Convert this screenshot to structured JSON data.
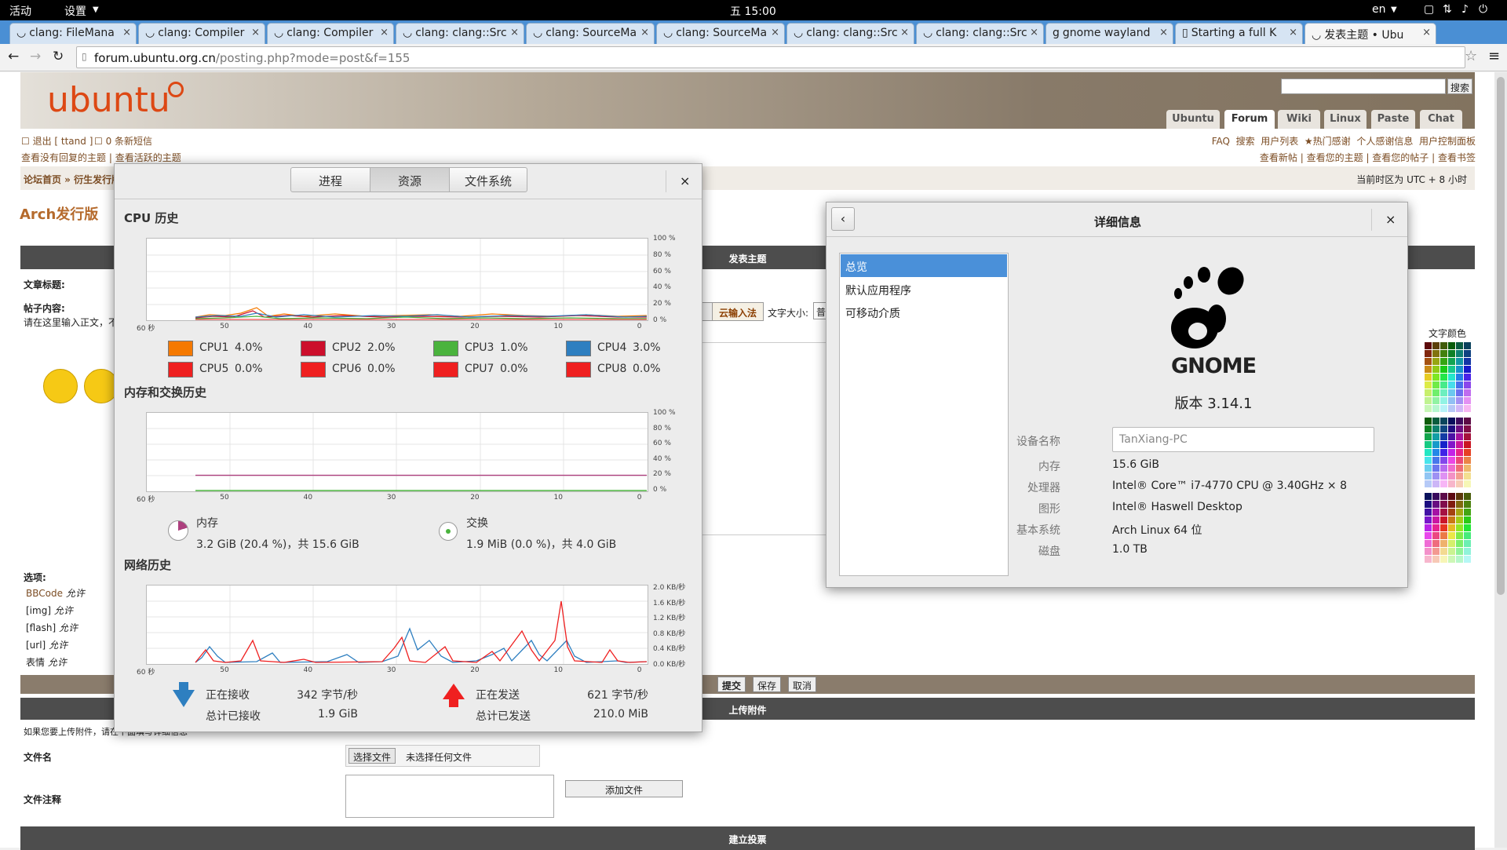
{
  "topbar": {
    "activities": "活动",
    "app_menu": "设置",
    "clock": "五 15:00",
    "lang": "en"
  },
  "tabs": [
    {
      "label": "clang: FileMana"
    },
    {
      "label": "clang: Compiler"
    },
    {
      "label": "clang: Compiler"
    },
    {
      "label": "clang: clang::Src"
    },
    {
      "label": "clang: SourceMa"
    },
    {
      "label": "clang: SourceMa"
    },
    {
      "label": "clang: clang::Src"
    },
    {
      "label": "clang: clang::Src"
    },
    {
      "label": "gnome wayland"
    },
    {
      "label": "Starting a full K"
    },
    {
      "label": "发表主题 • Ubu"
    }
  ],
  "address": {
    "domain": "forum.ubuntu.org.cn",
    "path": "/posting.php?mode=post&f=155"
  },
  "forum": {
    "logo": "ubuntu",
    "search_btn": "搜索",
    "nav_tabs": [
      "Ubuntu",
      "Forum",
      "Wiki",
      "Linux",
      "Paste",
      "Chat"
    ],
    "user_links": [
      "退出 [ ttand ]",
      "0 条新短信"
    ],
    "right_links": [
      "FAQ",
      "搜索",
      "用户列表",
      "热门感谢",
      "个人感谢信息",
      "用户控制面板"
    ],
    "topic_links": [
      "查看没有回复的主题",
      "查看活跃的主题"
    ],
    "right_links2": [
      "查看新帖",
      "查看您的主题",
      "查看您的帖子",
      "查看书签"
    ],
    "breadcrumb": "论坛首页 » 衍生发行版",
    "timezone": "当前时区为 UTC + 8 小时",
    "forum_title": "Arch发行版",
    "post_bar": "发表主题",
    "subject_label": "文章标题:",
    "content_label": "帖子内容:",
    "content_hint": "请在这里输入正文，不",
    "ime_btn": "云输入法",
    "fontsize_label": "文字大小:",
    "fontsize_val": "普通",
    "color_label": "文字颜色",
    "options_label": "选项:",
    "options": [
      [
        "BBCode",
        "允许"
      ],
      [
        "[img]",
        "允许"
      ],
      [
        "[flash]",
        "允许"
      ],
      [
        "[url]",
        "允许"
      ],
      [
        "表情",
        "允许"
      ]
    ],
    "buttons": [
      "提交",
      "保存",
      "取消"
    ],
    "upload_bar": "上传附件",
    "upload_hint": "如果您要上传附件，请在下面填写详细信息",
    "file_label": "文件名",
    "choose_file": "选择文件",
    "no_file": "未选择任何文件",
    "comment_label": "文件注释",
    "add_file": "添加文件",
    "poll_bar": "建立投票"
  },
  "sysmon": {
    "tabs": [
      "进程",
      "资源",
      "文件系统"
    ],
    "cpu_title": "CPU 历史",
    "mem_title": "内存和交换历史",
    "net_title": "网络历史",
    "x_labels": [
      "60 秒",
      "50",
      "40",
      "30",
      "20",
      "10",
      "0"
    ],
    "pct_labels": [
      "100 %",
      "80 %",
      "60 %",
      "40 %",
      "20 %",
      "0 %"
    ],
    "net_labels": [
      "2.0 KB/秒",
      "1.6 KB/秒",
      "1.2 KB/秒",
      "0.8 KB/秒",
      "0.4 KB/秒",
      "0.0 KB/秒"
    ],
    "cpus": [
      {
        "name": "CPU1",
        "val": "4.0%",
        "color": "#f57900"
      },
      {
        "name": "CPU2",
        "val": "2.0%",
        "color": "#cc0f2c"
      },
      {
        "name": "CPU3",
        "val": "1.0%",
        "color": "#4ab33d"
      },
      {
        "name": "CPU4",
        "val": "3.0%",
        "color": "#2e7fc0"
      },
      {
        "name": "CPU5",
        "val": "0.0%",
        "color": "#ef2020"
      },
      {
        "name": "CPU6",
        "val": "0.0%",
        "color": "#ef2020"
      },
      {
        "name": "CPU7",
        "val": "0.0%",
        "color": "#ef2020"
      },
      {
        "name": "CPU8",
        "val": "0.0%",
        "color": "#ef2020"
      }
    ],
    "mem": {
      "label": "内存",
      "detail": "3.2 GiB (20.4 %)，共 15.6 GiB",
      "color": "#ad3f7e"
    },
    "swap": {
      "label": "交换",
      "detail": "1.9 MiB (0.0 %)，共 4.0 GiB",
      "color": "#4ab33d"
    },
    "recv": {
      "label": "正在接收",
      "rate": "342 字节/秒",
      "total_label": "总计已接收",
      "total": "1.9 GiB"
    },
    "send": {
      "label": "正在发送",
      "rate": "621 字节/秒",
      "total_label": "总计已发送",
      "total": "210.0 MiB"
    }
  },
  "details": {
    "title": "详细信息",
    "sidebar": [
      "总览",
      "默认应用程序",
      "可移动介质"
    ],
    "logo_text": "GNOME",
    "version": "版本 3.14.1",
    "device_label": "设备名称",
    "device": "TanXiang-PC",
    "rows": [
      [
        "内存",
        "15.6 GiB"
      ],
      [
        "处理器",
        "Intel® Core™ i7-4770 CPU @ 3.40GHz × 8"
      ],
      [
        "图形",
        "Intel® Haswell Desktop"
      ],
      [
        "基本系统",
        "Arch Linux 64 位"
      ],
      [
        "磁盘",
        "1.0 TB"
      ]
    ]
  }
}
